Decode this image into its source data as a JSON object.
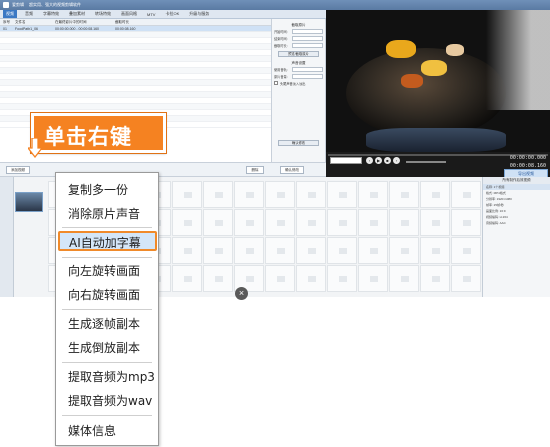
{
  "titlebar": {
    "app": "爱剪辑",
    "subtitle": "超实用、强大的视频剪辑软件"
  },
  "menubar": {
    "items": [
      "视频",
      "音频",
      "字幕特效",
      "叠加素材",
      "转场特效",
      "画面风格",
      "MTV",
      "卡拉OK",
      "升级与服务"
    ]
  },
  "filelist": {
    "headers": [
      "序号",
      "文件名",
      "在最终影片中的时间",
      "截取时长"
    ],
    "rows": [
      {
        "num": "01",
        "name": "FoodPath1_06",
        "time": "00:00:00.000 - 00:00:08.160",
        "dur": "00:00:08.160"
      }
    ]
  },
  "props": {
    "sect1": "截取原片",
    "labels": [
      "开始时间:",
      "结束时间:",
      "截取时长:"
    ],
    "preview_btn": "预览/截取原片",
    "sect2": "声音设置",
    "vol_labels": [
      "使用音轨:",
      "原片音量:"
    ],
    "checkbox": "头尾声音淡入淡出",
    "confirm": "确认修改"
  },
  "controls": {
    "current": "00:00:00.000",
    "total": "00:00:08.160"
  },
  "midbar": {
    "add_video": "添加视频",
    "delete": "删除"
  },
  "export": "导出视频",
  "right_panel": {
    "title": "所有制作后效视频",
    "lines": [
      "名称: 1个视频",
      "格式: MP4格式",
      "分辨率: 1920×1080",
      "帧率: 25帧/秒",
      "画面比例: 16:9",
      "视频编码: H.264",
      "音频编码: AAC"
    ]
  },
  "callout": {
    "text": "单击右键"
  },
  "close": "×",
  "timeline": {
    "thumb_label": "FoodPath1_06"
  },
  "context_menu": {
    "items": [
      {
        "label": "复制多一份"
      },
      {
        "label": "消除原片声音"
      },
      {
        "label": "AI自动加字幕",
        "highlighted": true
      },
      {
        "label": "向左旋转画面"
      },
      {
        "label": "向右旋转画面"
      },
      {
        "label": "生成逐帧副本"
      },
      {
        "label": "生成倒放副本"
      },
      {
        "label": "提取音频为mp3"
      },
      {
        "label": "提取音频为wav"
      },
      {
        "label": "媒体信息"
      }
    ]
  },
  "colors": {
    "accent": "#3a78c4",
    "callout": "#f58221",
    "highlight_border": "#f08a2a"
  }
}
